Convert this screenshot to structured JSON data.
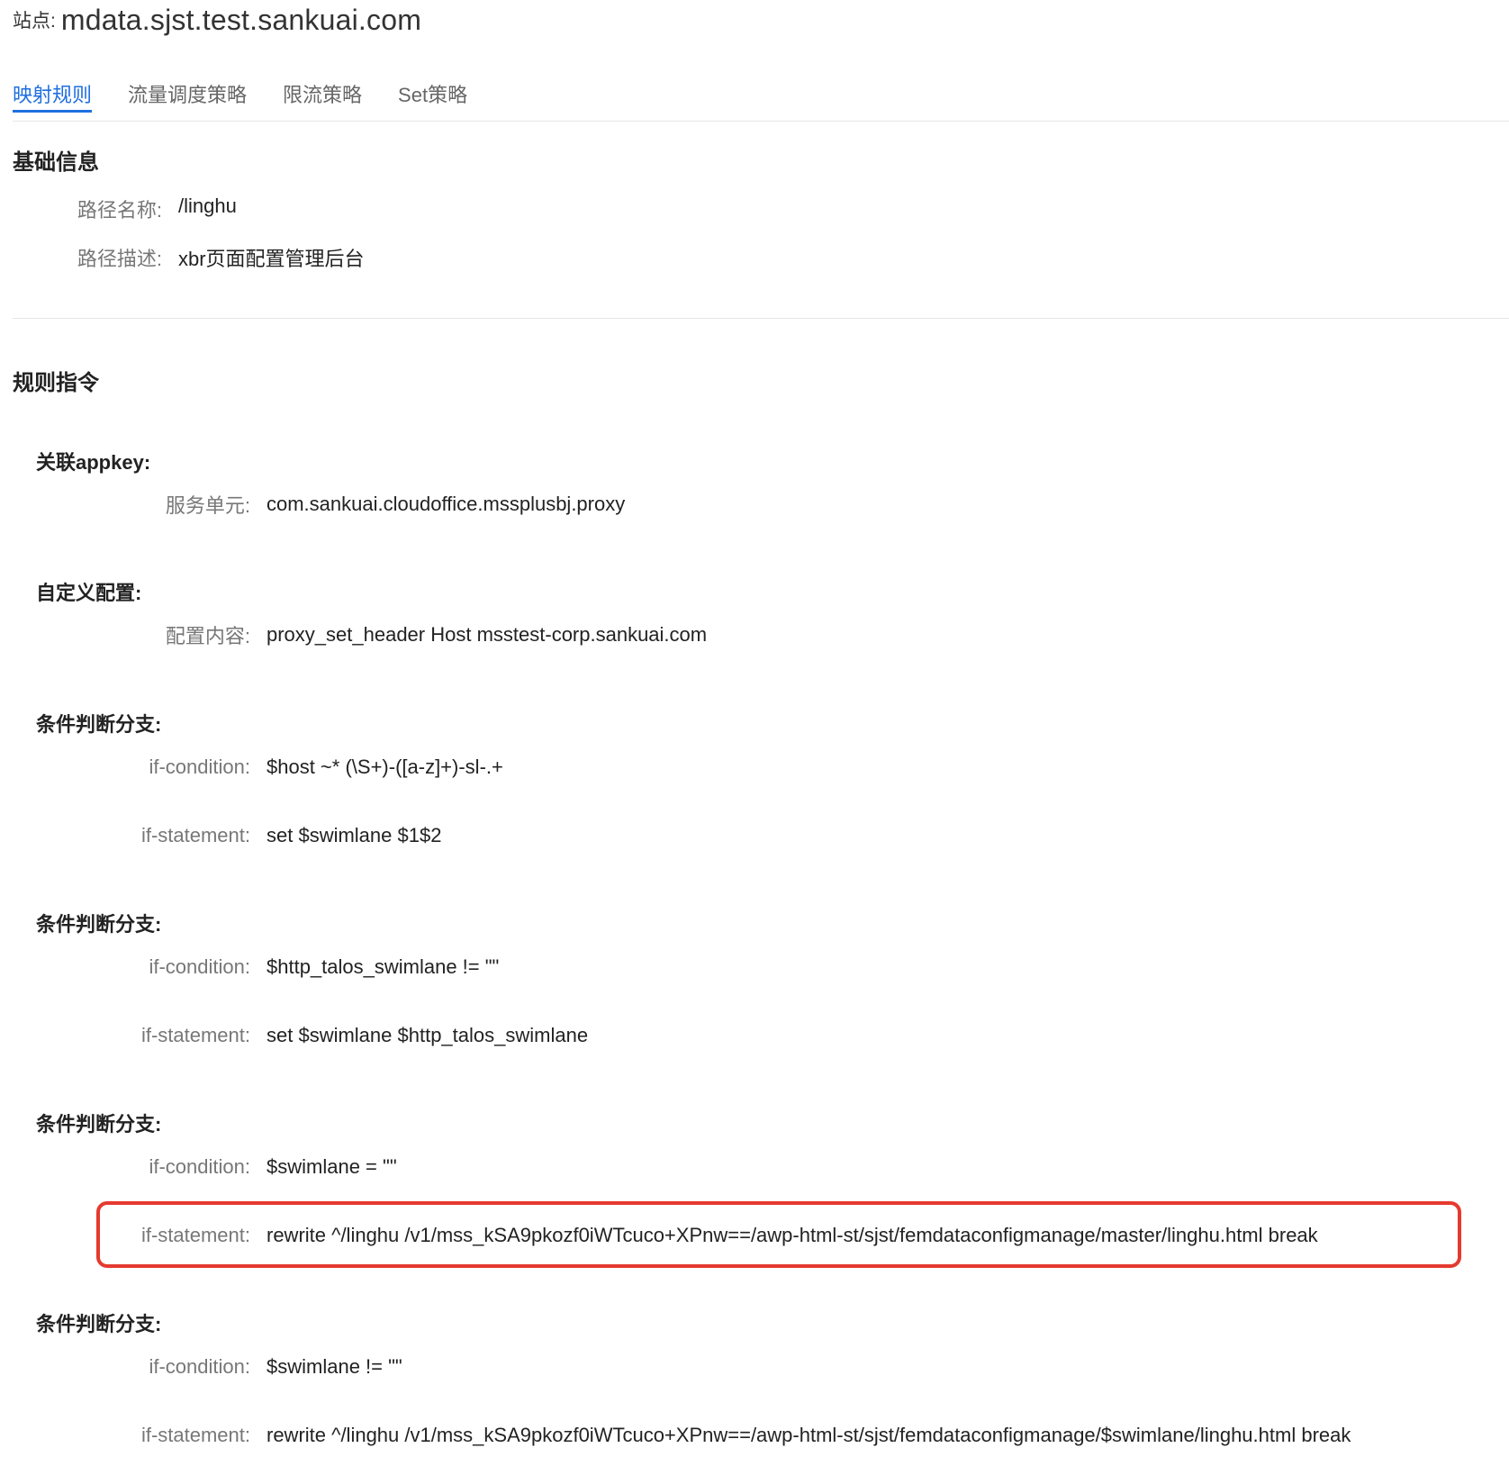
{
  "header": {
    "site_label": "站点:",
    "site_name": "mdata.sjst.test.sankuai.com"
  },
  "tabs": [
    {
      "label": "映射规则",
      "active": true
    },
    {
      "label": "流量调度策略",
      "active": false
    },
    {
      "label": "限流策略",
      "active": false
    },
    {
      "label": "Set策略",
      "active": false
    }
  ],
  "basic_info": {
    "title": "基础信息",
    "path_name_label": "路径名称:",
    "path_name_value": "/linghu",
    "path_desc_label": "路径描述:",
    "path_desc_value": "xbr页面配置管理后台"
  },
  "rules": {
    "title": "规则指令",
    "appkey": {
      "title": "关联appkey:",
      "service_label": "服务单元:",
      "service_value": "com.sankuai.cloudoffice.mssplusbj.proxy"
    },
    "custom": {
      "title": "自定义配置:",
      "content_label": "配置内容:",
      "content_value": "proxy_set_header Host msstest-corp.sankuai.com"
    },
    "branches": [
      {
        "title": "条件判断分支:",
        "condition_label": "if-condition:",
        "condition_value": "$host ~* (\\S+)-([a-z]+)-sl-.+",
        "statement_label": "if-statement:",
        "statement_value": "set $swimlane $1$2"
      },
      {
        "title": "条件判断分支:",
        "condition_label": "if-condition:",
        "condition_value": "$http_talos_swimlane != \"\"",
        "statement_label": "if-statement:",
        "statement_value": "set $swimlane $http_talos_swimlane"
      },
      {
        "title": "条件判断分支:",
        "condition_label": "if-condition:",
        "condition_value": "$swimlane = \"\"",
        "statement_label": "if-statement:",
        "statement_value": "rewrite ^/linghu /v1/mss_kSA9pkozf0iWTcuco+XPnw==/awp-html-st/sjst/femdataconfigmanage/master/linghu.html break"
      },
      {
        "title": "条件判断分支:",
        "condition_label": "if-condition:",
        "condition_value": "$swimlane != \"\"",
        "statement_label": "if-statement:",
        "statement_value": "rewrite ^/linghu /v1/mss_kSA9pkozf0iWTcuco+XPnw==/awp-html-st/sjst/femdataconfigmanage/$swimlane/linghu.html break"
      }
    ]
  },
  "colors": {
    "accent": "#1f6fe0",
    "highlight": "#e53a2f"
  }
}
